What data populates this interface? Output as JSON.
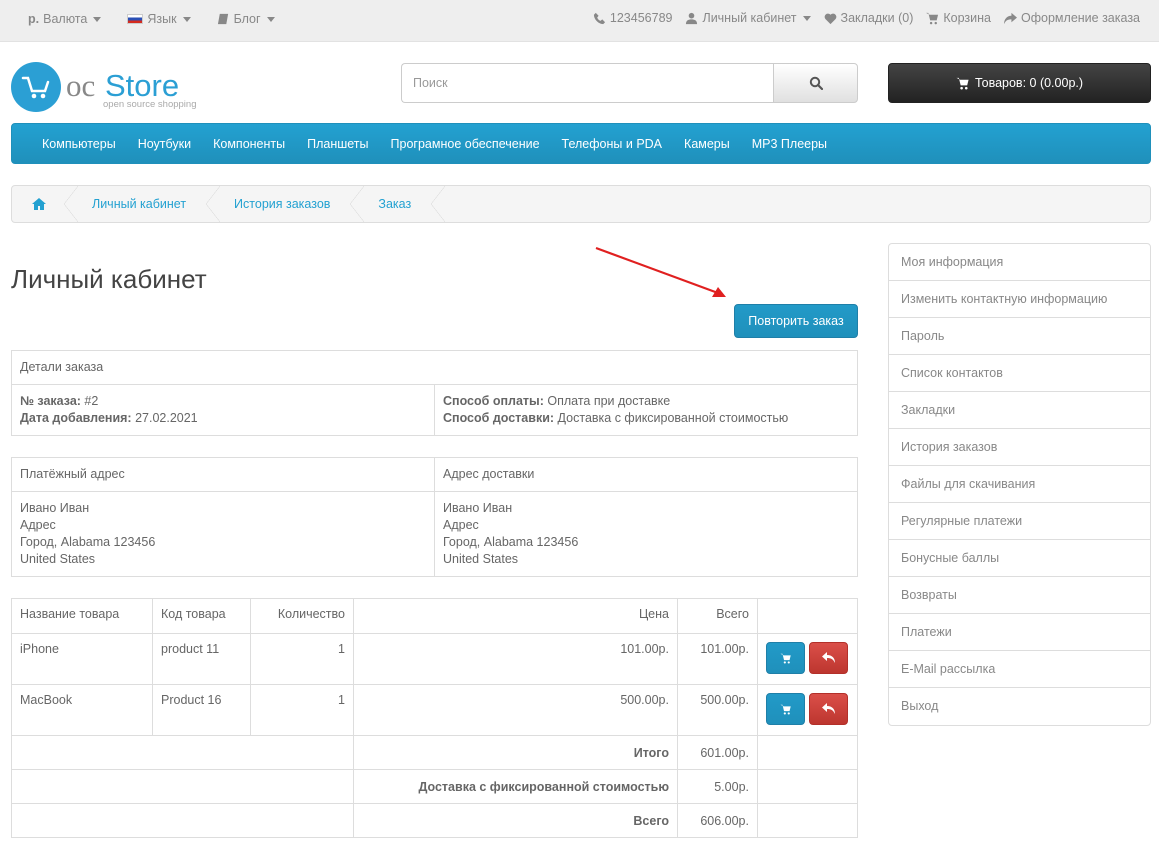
{
  "topbar": {
    "currency_symbol": "р.",
    "currency_label": "Валюта",
    "language_label": "Язык",
    "blog_label": "Блог",
    "phone": "123456789",
    "account_label": "Личный кабинет",
    "wishlist_label": "Закладки (0)",
    "cart_label": "Корзина",
    "checkout_label": "Оформление заказа"
  },
  "header": {
    "logo_main_1": "oc",
    "logo_main_2": "Store",
    "logo_tagline": "open source shopping",
    "search_placeholder": "Поиск",
    "cart_button": "Товаров: 0 (0.00р.)"
  },
  "menu": [
    "Компьютеры",
    "Ноутбуки",
    "Компоненты",
    "Планшеты",
    "Програмное обеспечение",
    "Телефоны и PDA",
    "Камеры",
    "MP3 Плееры"
  ],
  "breadcrumb": [
    "Личный кабинет",
    "История заказов",
    "Заказ"
  ],
  "page": {
    "title": "Личный кабинет",
    "reorder_button": "Повторить заказ"
  },
  "order_details": {
    "heading": "Детали заказа",
    "order_no_label": "№ заказа:",
    "order_no": "#2",
    "date_label": "Дата добавления:",
    "date": "27.02.2021",
    "payment_label": "Способ оплаты:",
    "payment": "Оплата при доставке",
    "shipping_label": "Способ доставки:",
    "shipping": "Доставка с фиксированной стоимостью"
  },
  "addresses": {
    "payment_heading": "Платёжный адрес",
    "shipping_heading": "Адрес доставки",
    "payment_lines": [
      "Ивано Иван",
      "Адрес",
      "Город, Alabama 123456",
      "United States"
    ],
    "shipping_lines": [
      "Ивано Иван",
      "Адрес",
      "Город, Alabama 123456",
      "United States"
    ]
  },
  "products": {
    "headers": [
      "Название товара",
      "Код товара",
      "Количество",
      "Цена",
      "Всего"
    ],
    "rows": [
      {
        "name": "iPhone",
        "model": "product 11",
        "qty": "1",
        "price": "101.00р.",
        "total": "101.00р."
      },
      {
        "name": "MacBook",
        "model": "Product 16",
        "qty": "1",
        "price": "500.00р.",
        "total": "500.00р."
      }
    ],
    "totals": [
      {
        "label": "Итого",
        "value": "601.00р."
      },
      {
        "label": "Доставка с фиксированной стоимостью",
        "value": "5.00р."
      },
      {
        "label": "Всего",
        "value": "606.00р."
      }
    ]
  },
  "sidebar": [
    "Моя информация",
    "Изменить контактную информацию",
    "Пароль",
    "Список контактов",
    "Закладки",
    "История заказов",
    "Файлы для скачивания",
    "Регулярные платежи",
    "Бонусные баллы",
    "Возвраты",
    "Платежи",
    "E-Mail рассылка",
    "Выход"
  ],
  "colors": {
    "accent": "#23a1d1",
    "danger": "#da4f49",
    "annotation_arrow": "#e02020"
  }
}
